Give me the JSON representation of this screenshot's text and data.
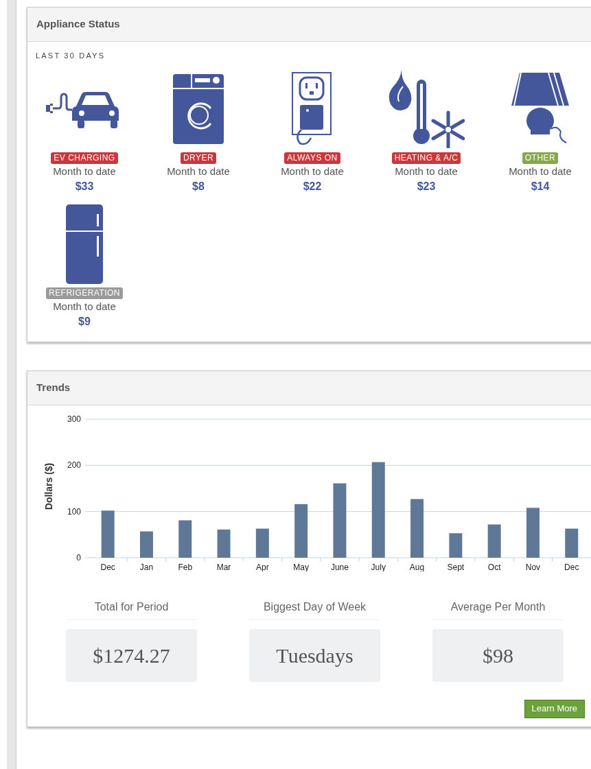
{
  "appliance_status": {
    "title": "Appliance Status",
    "period_label": "LAST 30 DAYS",
    "appliances": [
      {
        "kind": "car",
        "label": "EV CHARGING",
        "color": "#c9383a",
        "caption": "Month to date",
        "amount": "$33"
      },
      {
        "kind": "dryer",
        "label": "DRYER",
        "color": "#c9383a",
        "caption": "Month to date",
        "amount": "$8"
      },
      {
        "kind": "outlet",
        "label": "ALWAYS ON",
        "color": "#c9383a",
        "caption": "Month to date",
        "amount": "$22"
      },
      {
        "kind": "climate",
        "label": "HEATING & A/C",
        "color": "#c9383a",
        "caption": "Month to date",
        "amount": "$23"
      },
      {
        "kind": "lamp",
        "label": "OTHER",
        "color": "#86a84a",
        "caption": "Month to date",
        "amount": "$14"
      },
      {
        "kind": "fridge",
        "label": "REFRIGERATION",
        "color": "#9a9a9a",
        "caption": "Month to date",
        "amount": "$9"
      }
    ]
  },
  "trends": {
    "title": "Trends",
    "chart_data": {
      "type": "bar",
      "ylabel": "Dollars ($)",
      "categories": [
        "Dec",
        "Jan",
        "Feb",
        "Mar",
        "Apr",
        "May",
        "June",
        "July",
        "Aug",
        "Sept",
        "Oct",
        "Nov",
        "Dec"
      ],
      "values": [
        102,
        57,
        81,
        61,
        63,
        116,
        161,
        207,
        127,
        53,
        72,
        108,
        63
      ],
      "ylim": [
        0,
        300
      ],
      "yticks": [
        0,
        100,
        200,
        300
      ]
    },
    "stats": [
      {
        "label": "Total for Period",
        "value": "$1274.27"
      },
      {
        "label": "Biggest Day of Week",
        "value": "Tuesdays"
      },
      {
        "label": "Average Per Month",
        "value": "$98"
      }
    ],
    "button": "Learn More"
  }
}
